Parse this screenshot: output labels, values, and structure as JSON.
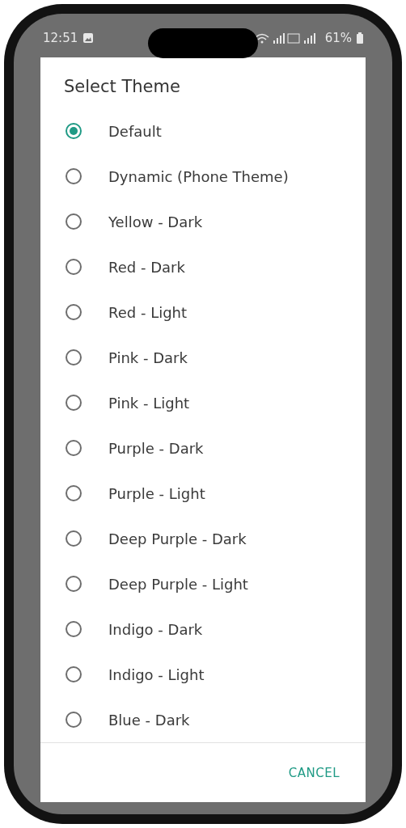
{
  "status_bar": {
    "time": "12:51",
    "battery": "61%"
  },
  "dialog": {
    "title": "Select Theme",
    "options": [
      {
        "label": "Default",
        "selected": true
      },
      {
        "label": "Dynamic (Phone Theme)",
        "selected": false
      },
      {
        "label": "Yellow - Dark",
        "selected": false
      },
      {
        "label": "Red - Dark",
        "selected": false
      },
      {
        "label": "Red - Light",
        "selected": false
      },
      {
        "label": "Pink - Dark",
        "selected": false
      },
      {
        "label": "Pink - Light",
        "selected": false
      },
      {
        "label": "Purple - Dark",
        "selected": false
      },
      {
        "label": "Purple - Light",
        "selected": false
      },
      {
        "label": "Deep Purple - Dark",
        "selected": false
      },
      {
        "label": "Deep Purple - Light",
        "selected": false
      },
      {
        "label": "Indigo - Dark",
        "selected": false
      },
      {
        "label": "Indigo - Light",
        "selected": false
      },
      {
        "label": "Blue - Dark",
        "selected": false
      }
    ],
    "buttons": [
      "CANCEL"
    ]
  }
}
